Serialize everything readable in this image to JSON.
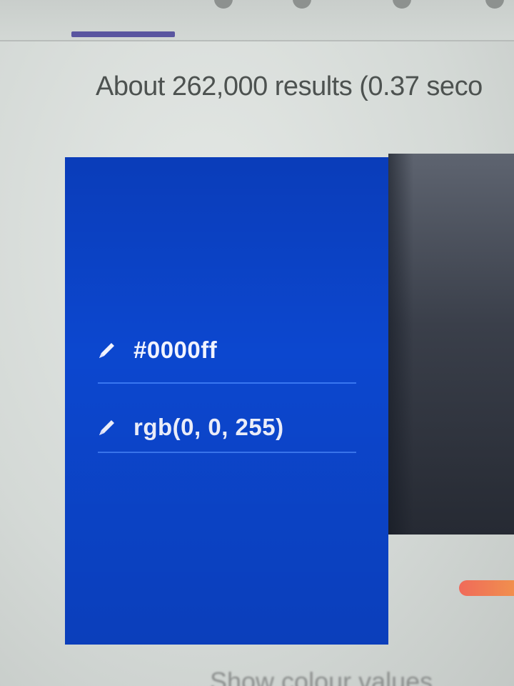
{
  "results": {
    "stats_text": "About 262,000 results (0.37 seco"
  },
  "colour_picker": {
    "hex_value": "#0000ff",
    "rgb_value": "rgb(0, 0, 255)",
    "hex_edit_icon": "pencil-icon",
    "rgb_edit_icon": "pencil-icon",
    "swatch_color": "#0000ff",
    "show_values_label": "Show colour values"
  },
  "colors": {
    "tab_indicator": "#5a56a0",
    "value_underline": "#3a78f2",
    "slider_start": "#f06a5a",
    "slider_end": "#f19a4a"
  }
}
